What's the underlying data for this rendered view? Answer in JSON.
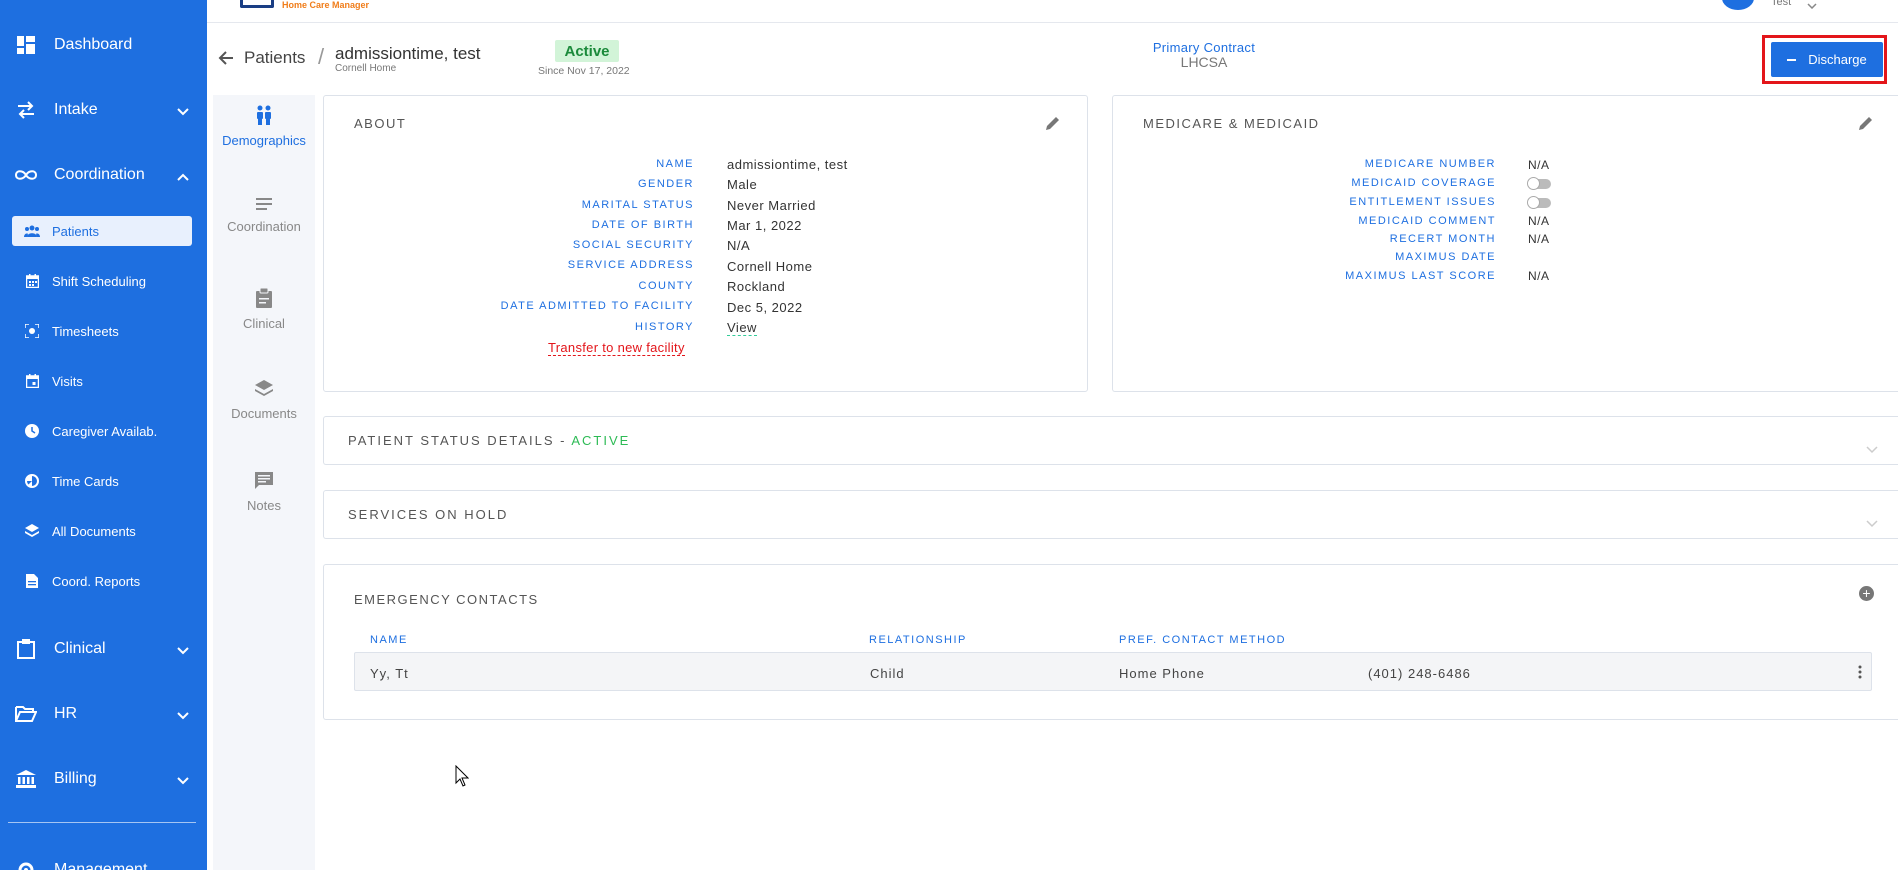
{
  "sidebar": {
    "items": [
      {
        "label": "Dashboard"
      },
      {
        "label": "Intake"
      },
      {
        "label": "Coordination"
      },
      {
        "label": "Clinical"
      },
      {
        "label": "HR"
      },
      {
        "label": "Billing"
      },
      {
        "label": "Management"
      }
    ],
    "sub_items": [
      {
        "label": "Patients"
      },
      {
        "label": "Shift Scheduling"
      },
      {
        "label": "Timesheets"
      },
      {
        "label": "Visits"
      },
      {
        "label": "Caregiver Availab."
      },
      {
        "label": "Time Cards"
      },
      {
        "label": "All Documents"
      },
      {
        "label": "Coord. Reports"
      }
    ]
  },
  "topbar": {
    "logo_text": "Home Care Manager",
    "user_name": "Test"
  },
  "header": {
    "breadcrumb_parent": "Patients",
    "separator": "/",
    "patient_name": "admissiontime, test",
    "patient_location": "Cornell Home",
    "status": "Active",
    "status_since": "Since Nov 17, 2022",
    "primary_contract_label": "Primary Contract",
    "primary_contract_value": "LHCSA",
    "discharge_label": "Discharge"
  },
  "tabs": [
    {
      "label": "Demographics"
    },
    {
      "label": "Coordination"
    },
    {
      "label": "Clinical"
    },
    {
      "label": "Documents"
    },
    {
      "label": "Notes"
    }
  ],
  "about": {
    "title": "ABOUT",
    "fields": [
      {
        "label": "NAME",
        "value": "admissiontime, test"
      },
      {
        "label": "GENDER",
        "value": "Male"
      },
      {
        "label": "MARITAL STATUS",
        "value": "Never Married"
      },
      {
        "label": "DATE OF BIRTH",
        "value": "Mar 1, 2022"
      },
      {
        "label": "SOCIAL SECURITY",
        "value": "N/A"
      },
      {
        "label": "SERVICE ADDRESS",
        "value": "Cornell Home"
      },
      {
        "label": "COUNTY",
        "value": "Rockland"
      },
      {
        "label": "DATE ADMITTED TO FACILITY",
        "value": "Dec 5, 2022"
      },
      {
        "label": "HISTORY",
        "value": "View"
      }
    ],
    "transfer_link": "Transfer to new facility"
  },
  "medicare": {
    "title": "MEDICARE & MEDICAID",
    "fields": [
      {
        "label": "MEDICARE NUMBER",
        "value": "N/A"
      },
      {
        "label": "MEDICAID COVERAGE",
        "value": ""
      },
      {
        "label": "ENTITLEMENT ISSUES",
        "value": ""
      },
      {
        "label": "MEDICAID COMMENT",
        "value": "N/A"
      },
      {
        "label": "RECERT MONTH",
        "value": "N/A"
      },
      {
        "label": "MAXIMUS DATE",
        "value": ""
      },
      {
        "label": "MAXIMUS LAST SCORE",
        "value": "N/A"
      }
    ],
    "medicaid_coverage_on": false,
    "entitlement_issues_on": false
  },
  "patient_status": {
    "title": "PATIENT STATUS DETAILS - ",
    "status": "ACTIVE"
  },
  "services_on_hold": {
    "title": "SERVICES ON HOLD"
  },
  "emergency_contacts": {
    "title": "EMERGENCY CONTACTS",
    "columns": [
      "NAME",
      "RELATIONSHIP",
      "PREF. CONTACT METHOD"
    ],
    "rows": [
      {
        "name": "Yy, Tt",
        "relationship": "Child",
        "method": "Home Phone",
        "phone": "(401) 248-6486"
      }
    ]
  },
  "colors": {
    "primary": "#1e6fe0",
    "active_green": "#2dbb55",
    "alert_red": "#e3151a"
  }
}
